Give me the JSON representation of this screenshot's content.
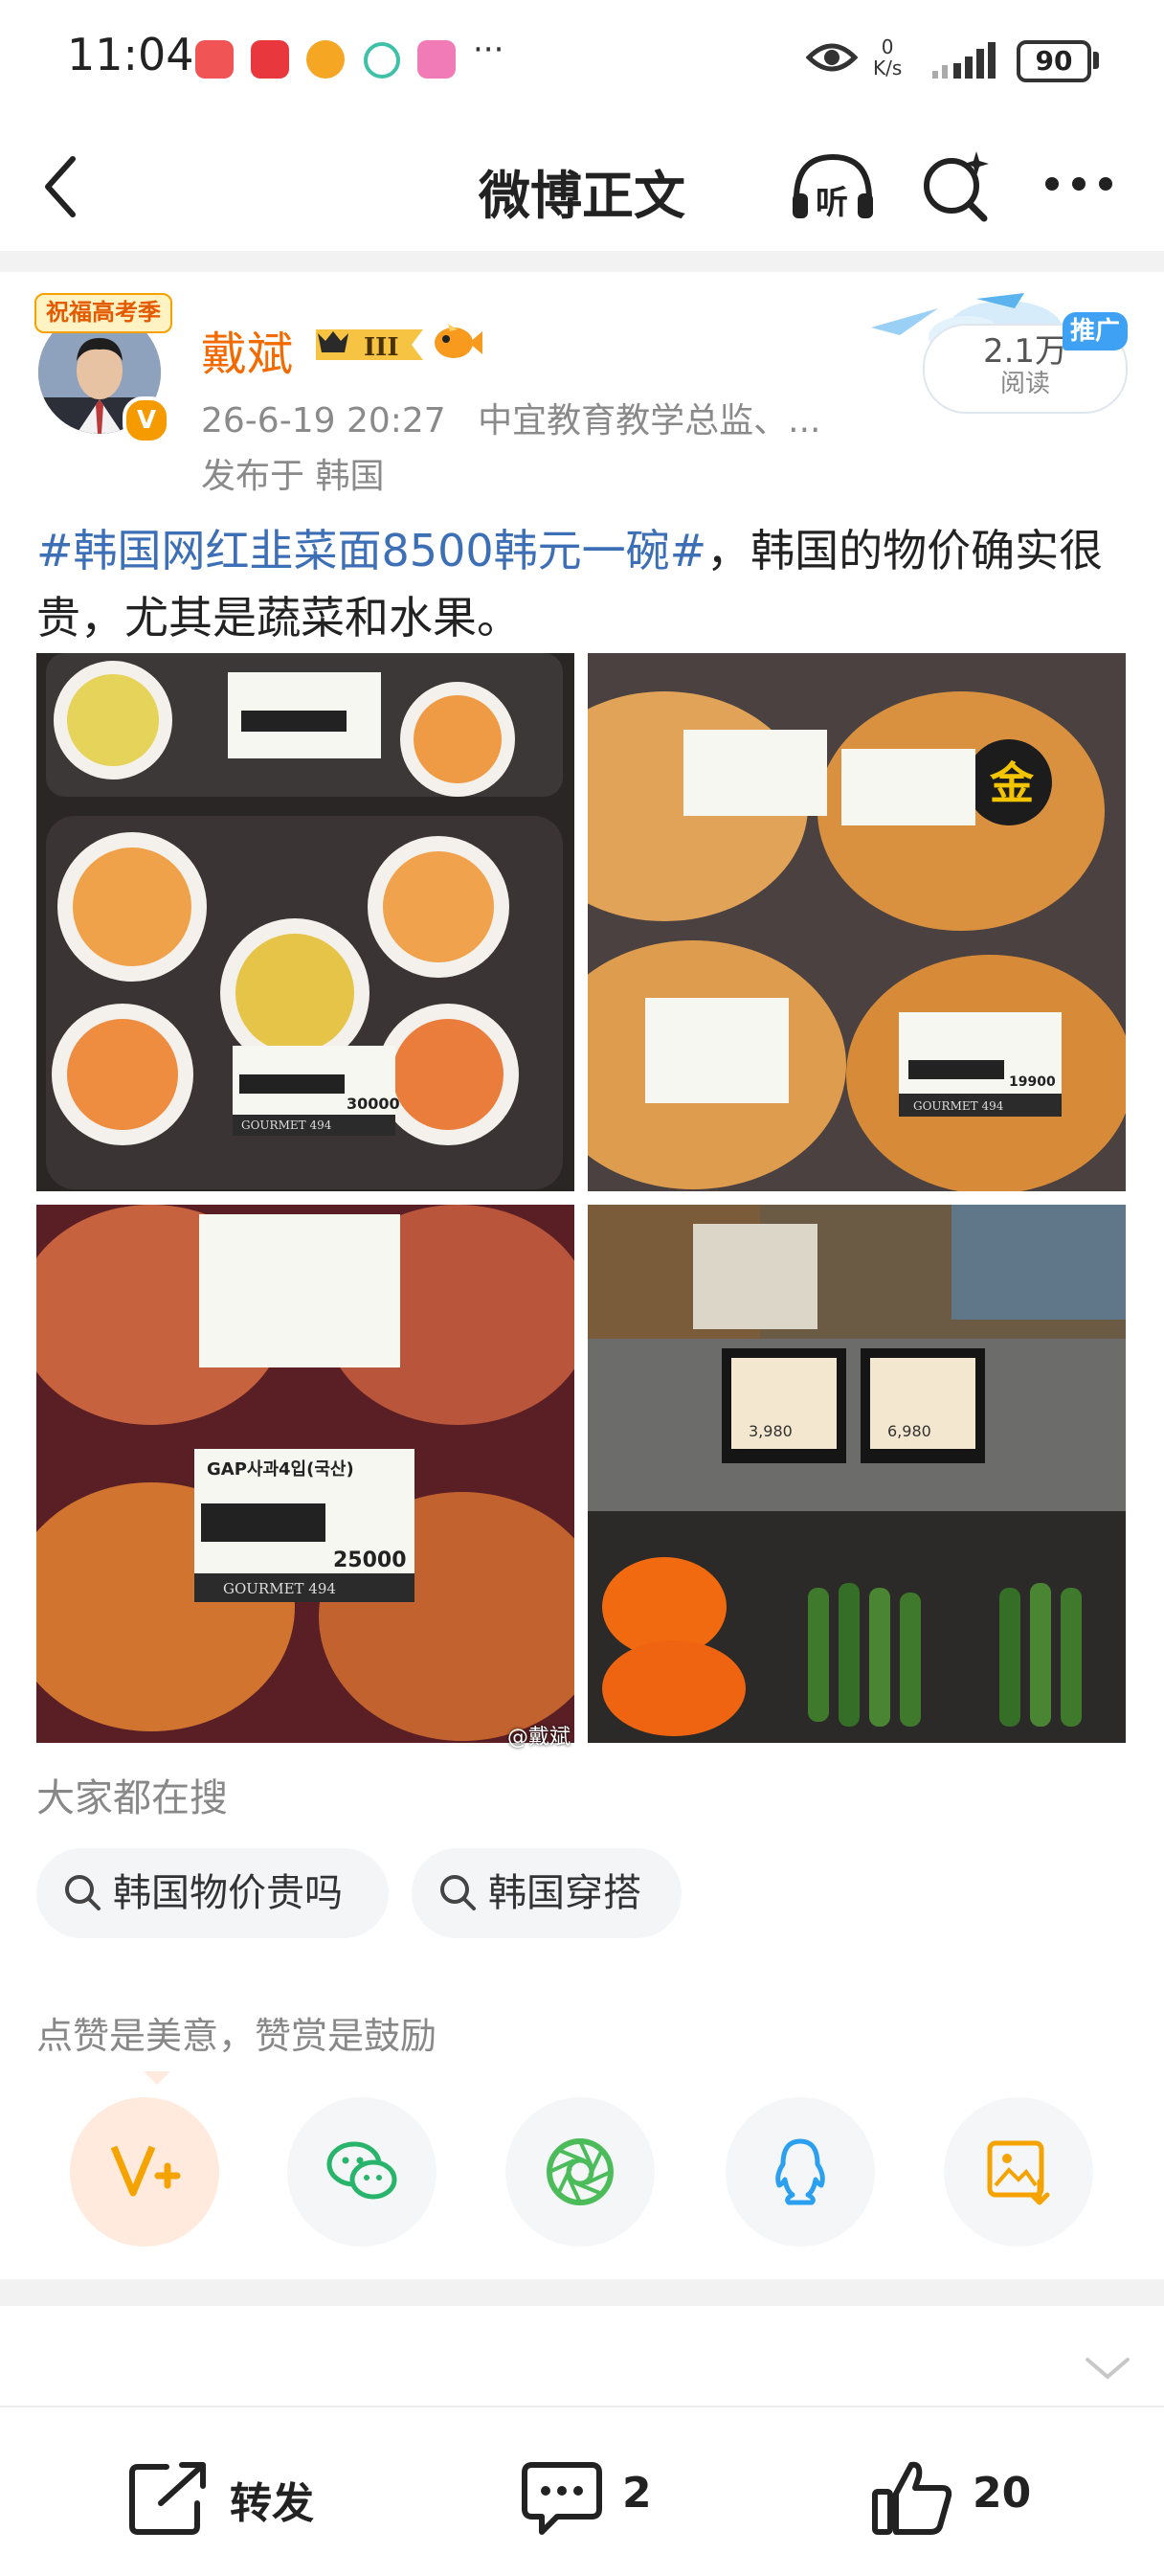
{
  "status_bar": {
    "time": "11:04",
    "more": "···",
    "net_speed_value": "0",
    "net_speed_unit": "K/s",
    "battery": "90",
    "app_colors": [
      "#f05454",
      "#e8383d",
      "#f5a623",
      "#3fc1a8",
      "#f07bb6"
    ]
  },
  "nav": {
    "title": "微博正文",
    "back_icon": "back-arrow-icon",
    "listen_label": "听",
    "search_icon": "search-sparkle-icon",
    "more_icon": "more-dots-icon"
  },
  "post": {
    "exam_badge": "祝福高考季",
    "username": "戴斌",
    "level": "III",
    "verified_mark": "V",
    "timestamp": "26-6-19 20:27",
    "author_title": "中宜教育教学总监、...",
    "location": "发布于 韩国",
    "read_count": "2.1万",
    "read_label": "阅读",
    "promo_tag": "推广",
    "topic": "#韩国网红韭菜面8500韩元一碗#",
    "body": "，韩国的物价确实很贵，尤其是蔬菜和水果。",
    "photos": [
      {
        "subject": "peaches",
        "price_label": "30000",
        "store": "GOURMET 494"
      },
      {
        "subject": "melons",
        "price_label": "19900",
        "store": "GOURMET 494"
      },
      {
        "subject": "apples",
        "price_label": "25000",
        "store": "GOURMET 494",
        "product": "GAP사과4입(국산)"
      },
      {
        "subject": "vegetables",
        "price_a": "3,980",
        "price_b": "6,980"
      }
    ],
    "watermark": "@戴斌"
  },
  "trending": {
    "label": "大家都在搜",
    "chips": [
      "韩国物价贵吗",
      "韩国穿搭"
    ]
  },
  "reward": {
    "label": "点赞是美意，赞赏是鼓励"
  },
  "share_icons": [
    "v-plus-icon",
    "wechat-icon",
    "moments-icon",
    "qq-icon",
    "save-image-icon"
  ],
  "colors": {
    "accent_orange": "#f26a00",
    "topic_blue": "#3d6fb6",
    "wechat_green": "#28b46a",
    "qq_blue": "#2ba0f0",
    "image_orange": "#f5a300"
  },
  "bottom_bar": {
    "repost_label": "转发",
    "comment_count": "2",
    "like_count": "20"
  }
}
